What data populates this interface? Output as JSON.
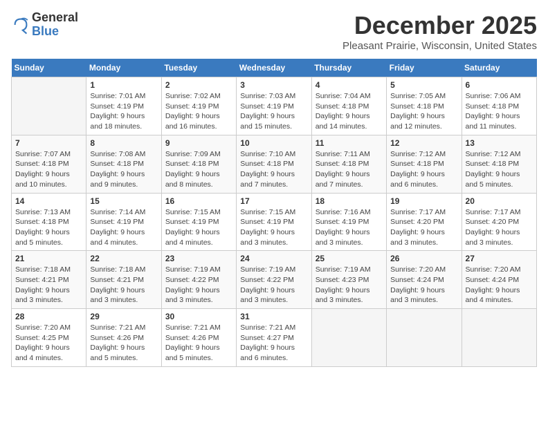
{
  "logo": {
    "general": "General",
    "blue": "Blue"
  },
  "title": "December 2025",
  "location": "Pleasant Prairie, Wisconsin, United States",
  "days_of_week": [
    "Sunday",
    "Monday",
    "Tuesday",
    "Wednesday",
    "Thursday",
    "Friday",
    "Saturday"
  ],
  "weeks": [
    [
      {
        "num": "",
        "info": ""
      },
      {
        "num": "1",
        "info": "Sunrise: 7:01 AM\nSunset: 4:19 PM\nDaylight: 9 hours\nand 18 minutes."
      },
      {
        "num": "2",
        "info": "Sunrise: 7:02 AM\nSunset: 4:19 PM\nDaylight: 9 hours\nand 16 minutes."
      },
      {
        "num": "3",
        "info": "Sunrise: 7:03 AM\nSunset: 4:19 PM\nDaylight: 9 hours\nand 15 minutes."
      },
      {
        "num": "4",
        "info": "Sunrise: 7:04 AM\nSunset: 4:18 PM\nDaylight: 9 hours\nand 14 minutes."
      },
      {
        "num": "5",
        "info": "Sunrise: 7:05 AM\nSunset: 4:18 PM\nDaylight: 9 hours\nand 12 minutes."
      },
      {
        "num": "6",
        "info": "Sunrise: 7:06 AM\nSunset: 4:18 PM\nDaylight: 9 hours\nand 11 minutes."
      }
    ],
    [
      {
        "num": "7",
        "info": "Sunrise: 7:07 AM\nSunset: 4:18 PM\nDaylight: 9 hours\nand 10 minutes."
      },
      {
        "num": "8",
        "info": "Sunrise: 7:08 AM\nSunset: 4:18 PM\nDaylight: 9 hours\nand 9 minutes."
      },
      {
        "num": "9",
        "info": "Sunrise: 7:09 AM\nSunset: 4:18 PM\nDaylight: 9 hours\nand 8 minutes."
      },
      {
        "num": "10",
        "info": "Sunrise: 7:10 AM\nSunset: 4:18 PM\nDaylight: 9 hours\nand 7 minutes."
      },
      {
        "num": "11",
        "info": "Sunrise: 7:11 AM\nSunset: 4:18 PM\nDaylight: 9 hours\nand 7 minutes."
      },
      {
        "num": "12",
        "info": "Sunrise: 7:12 AM\nSunset: 4:18 PM\nDaylight: 9 hours\nand 6 minutes."
      },
      {
        "num": "13",
        "info": "Sunrise: 7:12 AM\nSunset: 4:18 PM\nDaylight: 9 hours\nand 5 minutes."
      }
    ],
    [
      {
        "num": "14",
        "info": "Sunrise: 7:13 AM\nSunset: 4:18 PM\nDaylight: 9 hours\nand 5 minutes."
      },
      {
        "num": "15",
        "info": "Sunrise: 7:14 AM\nSunset: 4:19 PM\nDaylight: 9 hours\nand 4 minutes."
      },
      {
        "num": "16",
        "info": "Sunrise: 7:15 AM\nSunset: 4:19 PM\nDaylight: 9 hours\nand 4 minutes."
      },
      {
        "num": "17",
        "info": "Sunrise: 7:15 AM\nSunset: 4:19 PM\nDaylight: 9 hours\nand 3 minutes."
      },
      {
        "num": "18",
        "info": "Sunrise: 7:16 AM\nSunset: 4:19 PM\nDaylight: 9 hours\nand 3 minutes."
      },
      {
        "num": "19",
        "info": "Sunrise: 7:17 AM\nSunset: 4:20 PM\nDaylight: 9 hours\nand 3 minutes."
      },
      {
        "num": "20",
        "info": "Sunrise: 7:17 AM\nSunset: 4:20 PM\nDaylight: 9 hours\nand 3 minutes."
      }
    ],
    [
      {
        "num": "21",
        "info": "Sunrise: 7:18 AM\nSunset: 4:21 PM\nDaylight: 9 hours\nand 3 minutes."
      },
      {
        "num": "22",
        "info": "Sunrise: 7:18 AM\nSunset: 4:21 PM\nDaylight: 9 hours\nand 3 minutes."
      },
      {
        "num": "23",
        "info": "Sunrise: 7:19 AM\nSunset: 4:22 PM\nDaylight: 9 hours\nand 3 minutes."
      },
      {
        "num": "24",
        "info": "Sunrise: 7:19 AM\nSunset: 4:22 PM\nDaylight: 9 hours\nand 3 minutes."
      },
      {
        "num": "25",
        "info": "Sunrise: 7:19 AM\nSunset: 4:23 PM\nDaylight: 9 hours\nand 3 minutes."
      },
      {
        "num": "26",
        "info": "Sunrise: 7:20 AM\nSunset: 4:24 PM\nDaylight: 9 hours\nand 3 minutes."
      },
      {
        "num": "27",
        "info": "Sunrise: 7:20 AM\nSunset: 4:24 PM\nDaylight: 9 hours\nand 4 minutes."
      }
    ],
    [
      {
        "num": "28",
        "info": "Sunrise: 7:20 AM\nSunset: 4:25 PM\nDaylight: 9 hours\nand 4 minutes."
      },
      {
        "num": "29",
        "info": "Sunrise: 7:21 AM\nSunset: 4:26 PM\nDaylight: 9 hours\nand 5 minutes."
      },
      {
        "num": "30",
        "info": "Sunrise: 7:21 AM\nSunset: 4:26 PM\nDaylight: 9 hours\nand 5 minutes."
      },
      {
        "num": "31",
        "info": "Sunrise: 7:21 AM\nSunset: 4:27 PM\nDaylight: 9 hours\nand 6 minutes."
      },
      {
        "num": "",
        "info": ""
      },
      {
        "num": "",
        "info": ""
      },
      {
        "num": "",
        "info": ""
      }
    ]
  ]
}
